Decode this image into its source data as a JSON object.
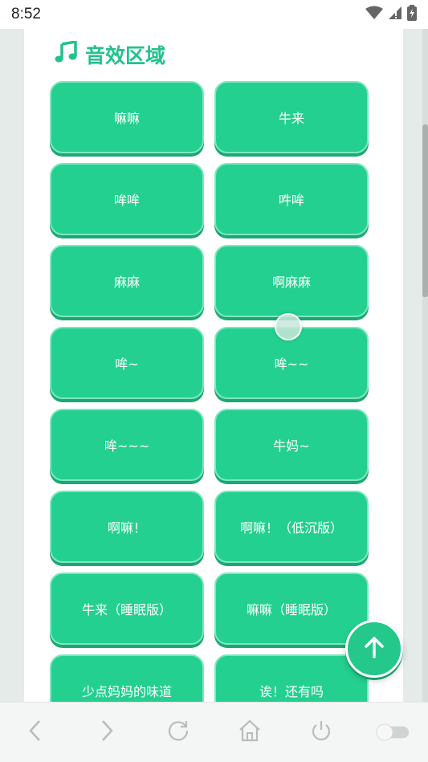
{
  "status_bar": {
    "time": "8:52",
    "icons": [
      "wifi-icon",
      "signal-icon",
      "battery-icon"
    ]
  },
  "section": {
    "title": "音效区域",
    "icon": "music-note-icon",
    "accent_color": "#22c28b"
  },
  "sound_buttons": [
    {
      "label": "嘛嘛"
    },
    {
      "label": "牛来"
    },
    {
      "label": "哞哞"
    },
    {
      "label": "吽哞"
    },
    {
      "label": "麻麻"
    },
    {
      "label": "啊麻麻"
    },
    {
      "label": "哞~"
    },
    {
      "label": "哞~~"
    },
    {
      "label": "哞~~~"
    },
    {
      "label": "牛妈~"
    },
    {
      "label": "啊嘛！"
    },
    {
      "label": "啊嘛！（低沉版）"
    },
    {
      "label": "牛来（睡眠版）"
    },
    {
      "label": "嘛嘛（睡眠版）"
    },
    {
      "label": "少点妈妈的味道"
    },
    {
      "label": "诶！还有吗"
    }
  ],
  "fab": {
    "icon": "arrow-up-icon"
  },
  "bottom_nav": {
    "items": [
      "back-icon",
      "forward-icon",
      "reload-icon",
      "home-icon",
      "power-icon",
      "toggle-switch"
    ]
  }
}
